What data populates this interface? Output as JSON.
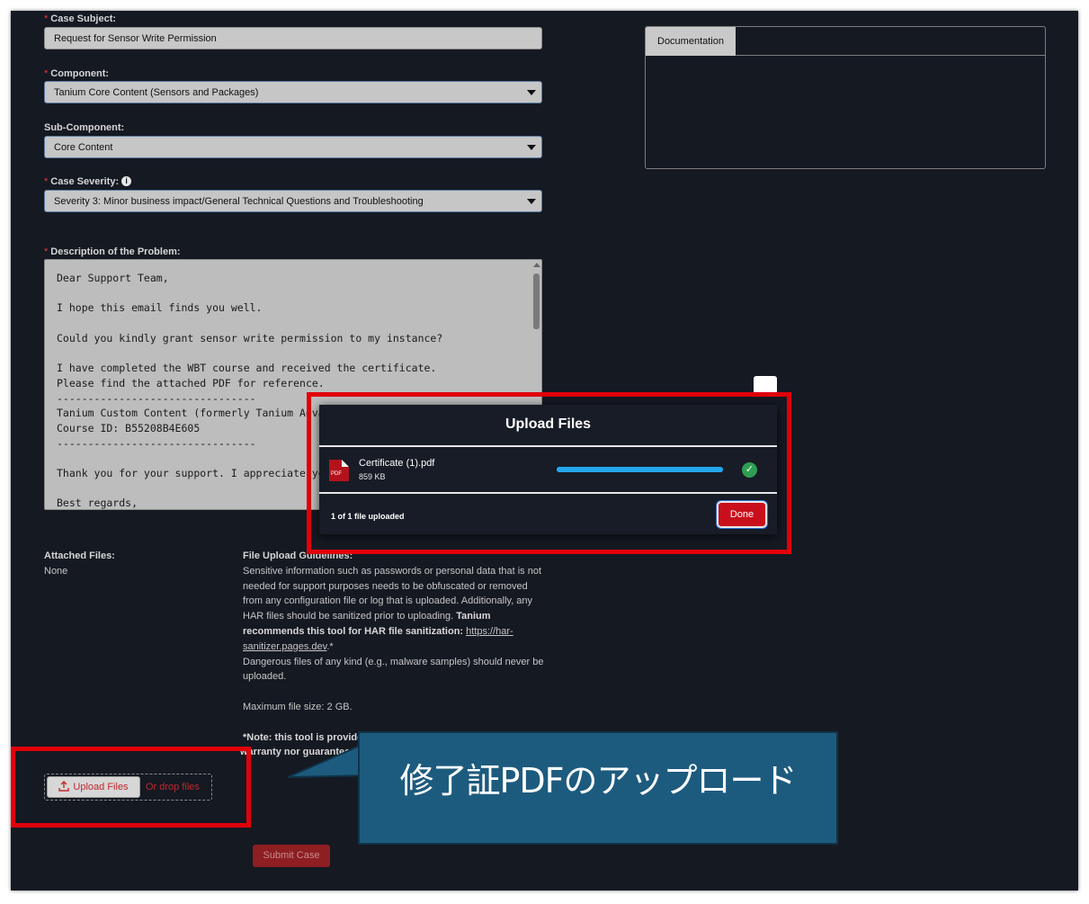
{
  "form": {
    "case_subject": {
      "label": "Case Subject:",
      "value": "Request for Sensor Write Permission"
    },
    "component": {
      "label": "Component:",
      "value": "Tanium Core Content (Sensors and Packages)"
    },
    "sub_component": {
      "label": "Sub-Component:",
      "value": "Core Content"
    },
    "case_severity": {
      "label": "Case Severity:",
      "value": "Severity 3: Minor business impact/General Technical Questions and Troubleshooting"
    },
    "required_marker": "*",
    "info_icon_glyph": "i",
    "description": {
      "label": "Description of the Problem:",
      "lines": [
        "Dear Support Team,",
        "",
        "I hope this email finds you well.",
        "",
        "Could you kindly grant sensor write permission to my instance?",
        "",
        "I have completed the WBT course and received the certificate.",
        "Please find the attached PDF for reference.",
        "--------------------------------",
        "Tanium Custom Content (formerly Tanium Advanced C",
        "Course ID: B55208B4E605",
        "--------------------------------",
        "",
        "Thank you for your support. I appreciate your time ar",
        "",
        "Best regards,"
      ]
    },
    "attached_files": {
      "label": "Attached Files:",
      "value": "None"
    },
    "guidelines": {
      "title": "File Upload Guidelines:",
      "p1": "Sensitive information such as passwords or personal data that is not needed for support purposes needs to be obfuscated or removed from any configuration file or log that is uploaded. Additionally, any HAR files should be sanitized prior to uploading.",
      "p1_bold": "Tanium recommends this tool for HAR file sanitization:",
      "link": "https://har-sanitizer.pages.dev",
      "link_suffix": ".*",
      "p2": "Dangerous files of any kind (e.g., malware samples) should never be uploaded.",
      "max_size": "Maximum file size: 2 GB.",
      "note_line1": "*Note: this tool is provided",
      "note_line2": "warranty nor guarantee i"
    },
    "upload_button": "Upload Files",
    "upload_icon": "upload-icon",
    "drop_text": "Or drop files",
    "submit_button": "Submit Case"
  },
  "side_panel": {
    "tab_label": "Documentation"
  },
  "modal": {
    "title": "Upload Files",
    "file": {
      "name": "Certificate (1).pdf",
      "size": "859 KB",
      "icon_label": "PDF",
      "progress": 1.0
    },
    "status": "1 of 1 file uploaded",
    "done_button": "Done"
  },
  "callout": {
    "text": "修了証PDFのアップロード"
  },
  "colors": {
    "highlight_red": "#e0000a",
    "callout_blue": "#1d5b7e",
    "progress_blue": "#23a6ee",
    "success_green": "#2e9e53"
  }
}
